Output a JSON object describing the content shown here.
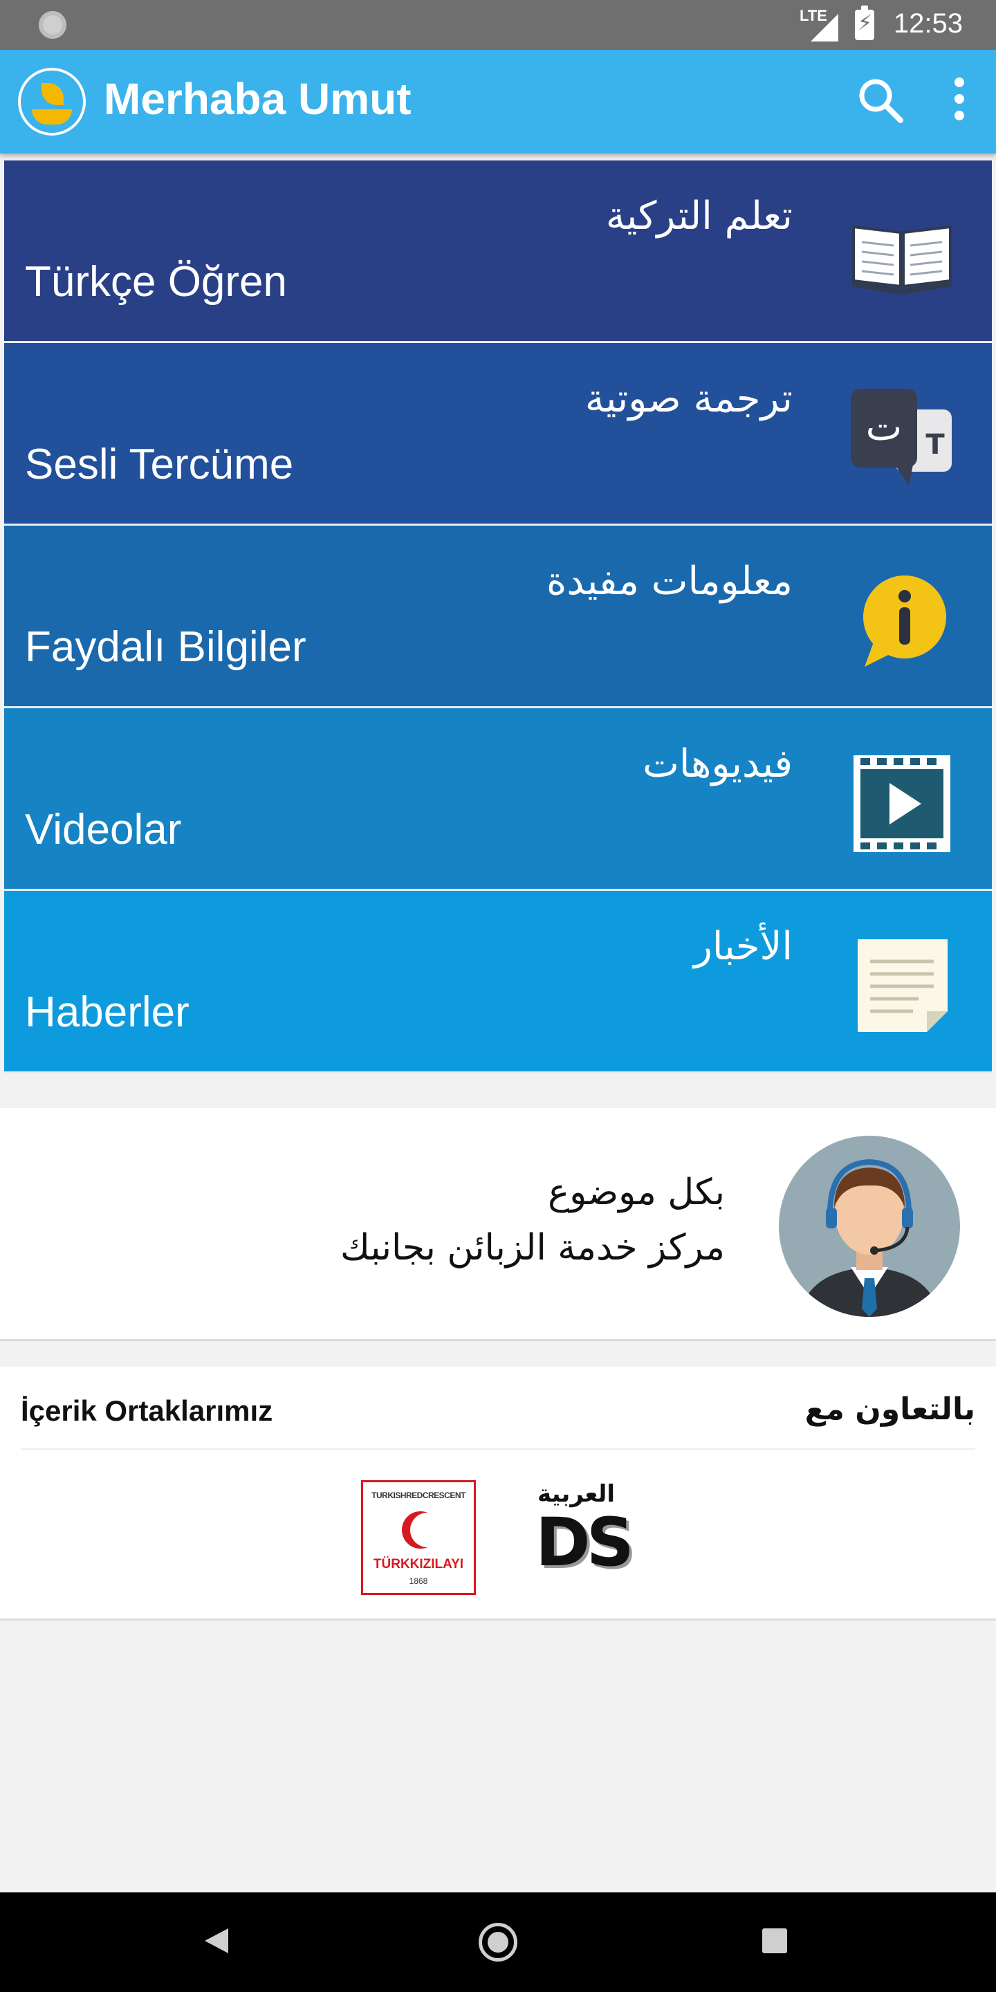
{
  "status_bar": {
    "network": "LTE",
    "time": "12:53"
  },
  "app_bar": {
    "title": "Merhaba Umut"
  },
  "menu": {
    "items": [
      {
        "arabic": "تعلم التركية",
        "turkish": "Türkçe Öğren",
        "icon": "book-icon",
        "color": "#293f86"
      },
      {
        "arabic": "ترجمة صوتية",
        "turkish": "Sesli Tercüme",
        "icon": "translate-icon",
        "color": "#22509a"
      },
      {
        "arabic": "معلومات مفيدة",
        "turkish": "Faydalı Bilgiler",
        "icon": "info-bubble-icon",
        "color": "#1b69ad"
      },
      {
        "arabic": "فيديوهات",
        "turkish": "Videolar",
        "icon": "video-play-icon",
        "color": "#1583c4"
      },
      {
        "arabic": "الأخبار",
        "turkish": "Haberler",
        "icon": "news-document-icon",
        "color": "#0d9bdd"
      }
    ]
  },
  "support": {
    "line1": "بكل موضوع",
    "line2": "مركز خدمة الزبائن بجانبك",
    "icon": "customer-service-agent-icon"
  },
  "partners": {
    "title_tr": "İçerik Ortaklarımız",
    "title_ar": "بالتعاون مع",
    "kizilay": {
      "top": "TURKISHREDCRESCENT",
      "name": "TÜRKKIZILAYI",
      "year": "1868"
    },
    "ds": {
      "arabic": "العربية",
      "letters": "DS"
    }
  },
  "colors": {
    "status_bar": "#6f6f6f",
    "app_bar": "#3ab2ec",
    "background": "#f2f2f2"
  }
}
